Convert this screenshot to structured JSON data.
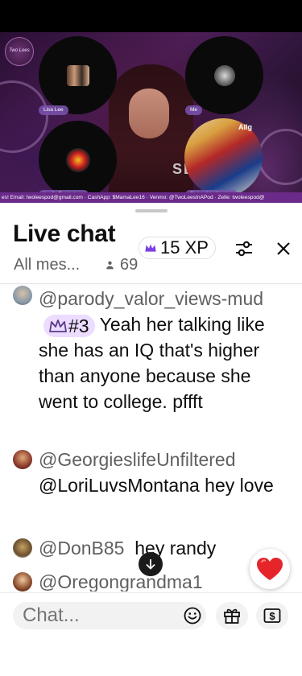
{
  "video": {
    "logo_text": "Two Lees",
    "stage_text": "SE",
    "sign_text": "Allg",
    "guests": [
      {
        "name": "Lisa Lee"
      },
      {
        "name": "Me"
      },
      {
        "name": "Leslie Ferderigos"
      },
      {
        "name": "Richard Luthmann"
      }
    ],
    "ticker": "es! Email: twoleespod@gmail.com · CashApp: $MamaLee16 · Venmo: @TwoLeesInAPod · Zelle: twoleespod@"
  },
  "chat": {
    "title": "Live chat",
    "filter": "All mes...",
    "viewers": "69",
    "xp": "15 XP",
    "accent_color": "#7b3fe4",
    "messages": [
      {
        "author": "@parody_valor_views-mud",
        "badge": "#3",
        "text": "Yeah her talking like she has an IQ that's higher than anyone because she went to college. pffft"
      },
      {
        "author": "@GeorgieslifeUnfiltered",
        "text": "@LoriLuvsMontana hey love"
      },
      {
        "author": "@DonB85",
        "text": "hey randy"
      },
      {
        "author": "@Oregongrandma1",
        "text": ""
      }
    ],
    "input_placeholder": "Chat..."
  },
  "icons": {
    "crown": "crown-icon",
    "viewers": "person-icon",
    "tune": "tune-icon",
    "close": "close-icon",
    "emoji": "smiley-icon",
    "gift": "gift-icon",
    "money": "money-icon",
    "heart": "heart-icon",
    "arrow": "arrow-down-icon"
  }
}
